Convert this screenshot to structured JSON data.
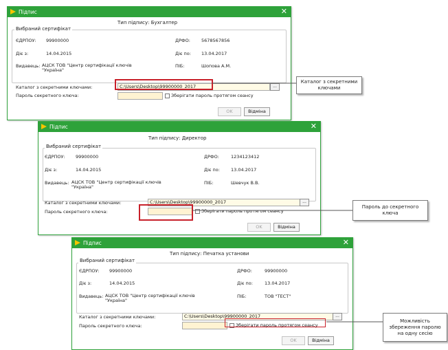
{
  "dialogs": [
    {
      "title": "Підпис",
      "signature_type": "Тип підпису: Бухгалтер",
      "cert_group": "Вибраний сертифікат",
      "edrpou_label": "ЄДРПОУ:",
      "edrpou_value": "99900000",
      "drfo_label": "ДРФО:",
      "drfo_value": "5678567856",
      "valid_from_label": "Діє з:",
      "valid_from_value": "14.04.2015",
      "valid_to_label": "Діє по:",
      "valid_to_value": "13.04.2017",
      "issuer_label": "Видавець:",
      "issuer_value_line1": "АЦСК ТОВ \"Центр сертифікації ключів",
      "issuer_value_line2": "\"Україна\"",
      "pib_label": "ПІБ:",
      "pib_value": "Шопова А.М.",
      "key_dir_label": "Каталог з секретними ключами:",
      "key_dir_value": "C:\\Users\\Desktop\\99900000_2017",
      "browse_label": "...",
      "password_label": "Пароль секретного ключа:",
      "password_value": "",
      "remember_label": "Зберігати пароль протягом сеансу",
      "ok_label": "OK",
      "cancel_label": "Відміна"
    },
    {
      "title": "Підпис",
      "signature_type": "Тип підпису: Директор",
      "cert_group": "Вибраний сертифікат",
      "edrpou_label": "ЄДРПОУ:",
      "edrpou_value": "99900000",
      "drfo_label": "ДРФО:",
      "drfo_value": "1234123412",
      "valid_from_label": "Діє з:",
      "valid_from_value": "14.04.2015",
      "valid_to_label": "Діє по:",
      "valid_to_value": "13.04.2017",
      "issuer_label": "Видавець:",
      "issuer_value_line1": "АЦСК ТОВ \"Центр сертифікації ключів",
      "issuer_value_line2": "\"Україна\"",
      "pib_label": "ПІБ:",
      "pib_value": "Шевчук В.В.",
      "key_dir_label": "Каталог з секретними ключами:",
      "key_dir_value": "C:\\Users\\Desktop\\99900000_2017",
      "browse_label": "...",
      "password_label": "Пароль секретного ключа:",
      "password_value": "",
      "remember_label": "Зберігати пароль протягом сеансу",
      "ok_label": "OK",
      "cancel_label": "Відміна"
    },
    {
      "title": "Підпис",
      "signature_type": "Тип підпису: Печатка установи",
      "cert_group": "Вибраний сертифікат",
      "edrpou_label": "ЄДРПОУ:",
      "edrpou_value": "99900000",
      "drfo_label": "ДРФО:",
      "drfo_value": "99900000",
      "valid_from_label": "Діє з:",
      "valid_from_value": "14.04.2015",
      "valid_to_label": "Діє по:",
      "valid_to_value": "13.04.2017",
      "issuer_label": "Видавець:",
      "issuer_value_line1": "АЦСК ТОВ \"Центр сертифікації ключів",
      "issuer_value_line2": "\"Україна\"",
      "pib_label": "ПІБ:",
      "pib_value": "ТОВ \"ТЕСТ\"",
      "key_dir_label": "Каталог з секретними ключами:",
      "key_dir_value": "C:\\Users\\Desktop\\99900000_2017",
      "browse_label": "...",
      "password_label": "Пароль секретного ключа:",
      "password_value": "",
      "remember_label": "Зберігати пароль протягом сеансу",
      "ok_label": "OK",
      "cancel_label": "Відміна"
    }
  ],
  "callouts": {
    "key_dir": "Каталог з секретними ключами",
    "password": "Пароль до секретного ключа",
    "remember": "Можливість збереження паролю на одну сесію"
  },
  "colors": {
    "titlebar": "#2ea23a",
    "highlight": "#c8202a",
    "input_bg": "#fffbe6"
  }
}
